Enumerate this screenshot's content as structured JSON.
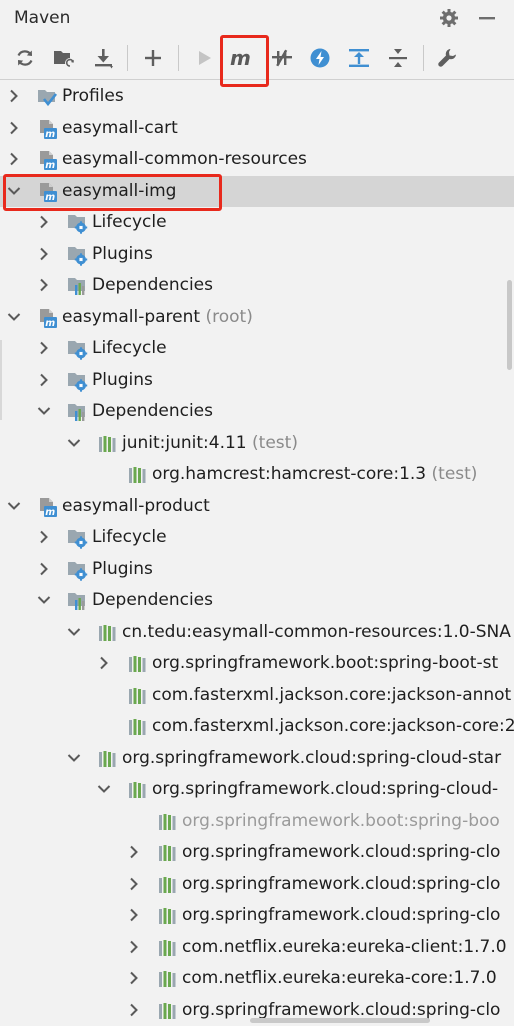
{
  "panel": {
    "title": "Maven",
    "settings_icon": "gear-icon",
    "minimize_icon": "minimize-icon"
  },
  "toolbar": [
    {
      "name": "reload-all-button",
      "icon": "reload-icon",
      "tooltip": ""
    },
    {
      "name": "generate-sources-button",
      "icon": "folder-refresh-icon"
    },
    {
      "name": "download-sources-button",
      "icon": "download-icon"
    },
    {
      "name": "add-maven-project-button",
      "icon": "plus-icon"
    },
    {
      "name": "run-button",
      "icon": "play-icon"
    },
    {
      "name": "execute-maven-goal-button",
      "icon": "maven-m-icon",
      "highlighted": true
    },
    {
      "name": "toggle-offline-mode-button",
      "icon": "offline-icon"
    },
    {
      "name": "skip-tests-button",
      "icon": "lightning-icon"
    },
    {
      "name": "show-dependencies-button",
      "icon": "expand-all-icon"
    },
    {
      "name": "collapse-all-button",
      "icon": "collapse-all-icon"
    },
    {
      "name": "maven-settings-button",
      "icon": "wrench-icon"
    }
  ],
  "tree": [
    {
      "text": "Profiles",
      "suffix": "",
      "level": 0,
      "arrow": "right",
      "icon": "profiles-icon",
      "selected": false,
      "gray": false
    },
    {
      "text": "easymall-cart",
      "suffix": "",
      "level": 0,
      "arrow": "right",
      "icon": "maven-module-icon",
      "selected": false,
      "gray": false
    },
    {
      "text": "easymall-common-resources",
      "suffix": "",
      "level": 0,
      "arrow": "right",
      "icon": "maven-module-icon",
      "selected": false,
      "gray": false
    },
    {
      "text": "easymall-img",
      "suffix": "",
      "level": 0,
      "arrow": "down",
      "icon": "maven-module-icon",
      "selected": true,
      "gray": false
    },
    {
      "text": "Lifecycle",
      "suffix": "",
      "level": 1,
      "arrow": "right",
      "icon": "lifecycle-folder-icon",
      "selected": false,
      "gray": false
    },
    {
      "text": "Plugins",
      "suffix": "",
      "level": 1,
      "arrow": "right",
      "icon": "lifecycle-folder-icon",
      "selected": false,
      "gray": false
    },
    {
      "text": "Dependencies",
      "suffix": "",
      "level": 1,
      "arrow": "right",
      "icon": "dependencies-folder-icon",
      "selected": false,
      "gray": false
    },
    {
      "text": "easymall-parent",
      "suffix": " (root)",
      "level": 0,
      "arrow": "down",
      "icon": "maven-module-icon",
      "selected": false,
      "gray": false
    },
    {
      "text": "Lifecycle",
      "suffix": "",
      "level": 1,
      "arrow": "right",
      "icon": "lifecycle-folder-icon",
      "selected": false,
      "gray": false
    },
    {
      "text": "Plugins",
      "suffix": "",
      "level": 1,
      "arrow": "right",
      "icon": "lifecycle-folder-icon",
      "selected": false,
      "gray": false
    },
    {
      "text": "Dependencies",
      "suffix": "",
      "level": 1,
      "arrow": "down",
      "icon": "dependencies-folder-icon",
      "selected": false,
      "gray": false
    },
    {
      "text": "junit:junit:4.11",
      "suffix": " (test)",
      "level": 2,
      "arrow": "down",
      "icon": "library-icon",
      "selected": false,
      "gray": false
    },
    {
      "text": "org.hamcrest:hamcrest-core:1.3",
      "suffix": " (test)",
      "level": 3,
      "arrow": "none",
      "icon": "library-icon",
      "selected": false,
      "gray": false
    },
    {
      "text": "easymall-product",
      "suffix": "",
      "level": 0,
      "arrow": "down",
      "icon": "maven-module-icon",
      "selected": false,
      "gray": false
    },
    {
      "text": "Lifecycle",
      "suffix": "",
      "level": 1,
      "arrow": "right",
      "icon": "lifecycle-folder-icon",
      "selected": false,
      "gray": false
    },
    {
      "text": "Plugins",
      "suffix": "",
      "level": 1,
      "arrow": "right",
      "icon": "lifecycle-folder-icon",
      "selected": false,
      "gray": false
    },
    {
      "text": "Dependencies",
      "suffix": "",
      "level": 1,
      "arrow": "down",
      "icon": "dependencies-folder-icon",
      "selected": false,
      "gray": false
    },
    {
      "text": "cn.tedu:easymall-common-resources:1.0-SNA",
      "suffix": "",
      "level": 2,
      "arrow": "down",
      "icon": "library-icon",
      "selected": false,
      "gray": false
    },
    {
      "text": "org.springframework.boot:spring-boot-st",
      "suffix": "",
      "level": 3,
      "arrow": "right",
      "icon": "library-icon",
      "selected": false,
      "gray": false
    },
    {
      "text": "com.fasterxml.jackson.core:jackson-annot",
      "suffix": "",
      "level": 3,
      "arrow": "none",
      "icon": "library-icon",
      "selected": false,
      "gray": false
    },
    {
      "text": "com.fasterxml.jackson.core:jackson-core:2",
      "suffix": "",
      "level": 3,
      "arrow": "none",
      "icon": "library-icon",
      "selected": false,
      "gray": false
    },
    {
      "text": "org.springframework.cloud:spring-cloud-star",
      "suffix": "",
      "level": 2,
      "arrow": "down",
      "icon": "library-icon",
      "selected": false,
      "gray": false
    },
    {
      "text": "org.springframework.cloud:spring-cloud-",
      "suffix": "",
      "level": 3,
      "arrow": "down",
      "icon": "library-icon",
      "selected": false,
      "gray": false
    },
    {
      "text": "org.springframework.boot:spring-boo",
      "suffix": "",
      "level": 4,
      "arrow": "none",
      "icon": "library-icon",
      "selected": false,
      "gray": true
    },
    {
      "text": "org.springframework.cloud:spring-clo",
      "suffix": "",
      "level": 4,
      "arrow": "right",
      "icon": "library-icon",
      "selected": false,
      "gray": false
    },
    {
      "text": "org.springframework.cloud:spring-clo",
      "suffix": "",
      "level": 4,
      "arrow": "right",
      "icon": "library-icon",
      "selected": false,
      "gray": false
    },
    {
      "text": "org.springframework.cloud:spring-clo",
      "suffix": "",
      "level": 4,
      "arrow": "right",
      "icon": "library-icon",
      "selected": false,
      "gray": false
    },
    {
      "text": "com.netflix.eureka:eureka-client:1.7.0",
      "suffix": "",
      "level": 4,
      "arrow": "right",
      "icon": "library-icon",
      "selected": false,
      "gray": false
    },
    {
      "text": "com.netflix.eureka:eureka-core:1.7.0",
      "suffix": "",
      "level": 4,
      "arrow": "right",
      "icon": "library-icon",
      "selected": false,
      "gray": false
    },
    {
      "text": "org.springframework.cloud:spring-clo",
      "suffix": "",
      "level": 4,
      "arrow": "right",
      "icon": "library-icon",
      "selected": false,
      "gray": false
    }
  ],
  "colors": {
    "highlight": "#e8291c",
    "selection": "#d5d5d5",
    "maven_blue": "#3f8fd2",
    "library_green": "#6aa84f"
  }
}
